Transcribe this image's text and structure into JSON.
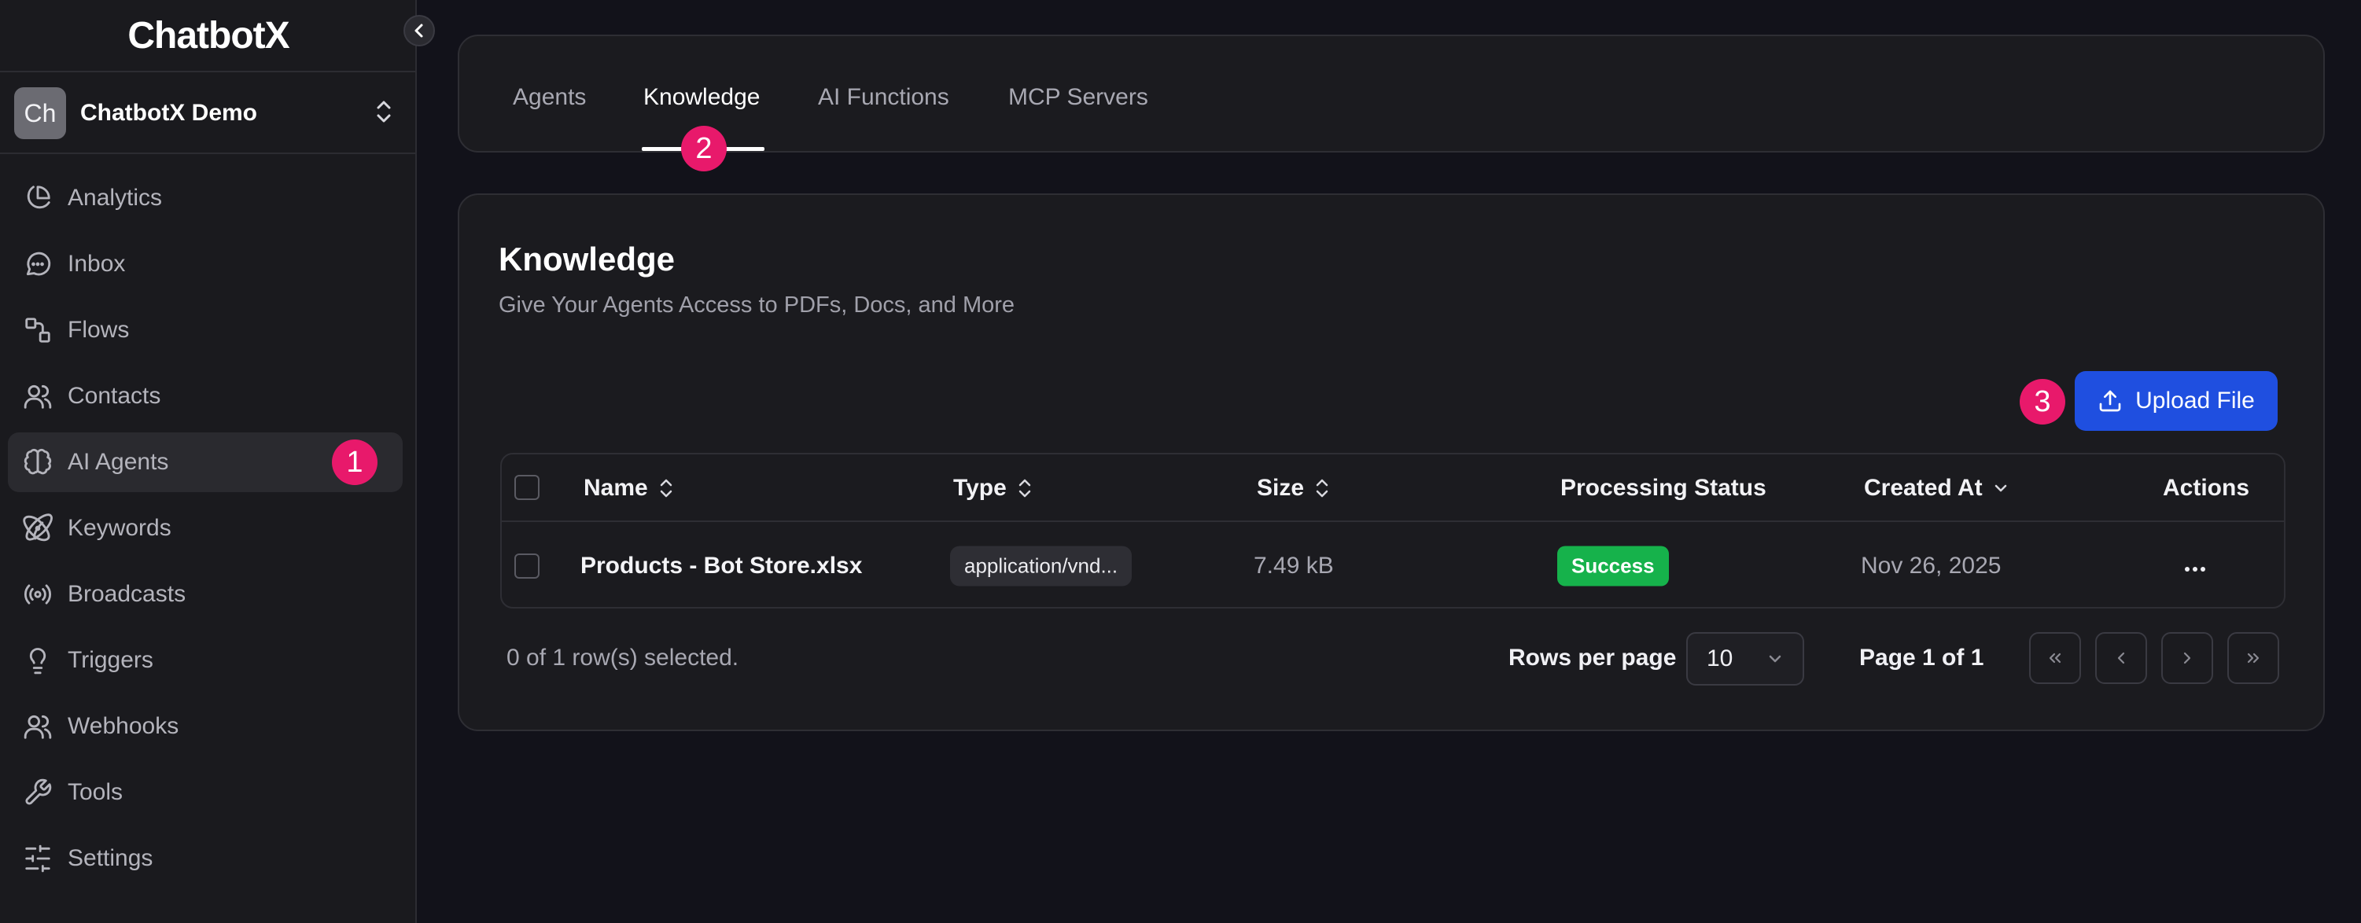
{
  "app": {
    "logo_text": "ChatbotX",
    "workspace": {
      "avatar_initials": "Ch",
      "name": "ChatbotX Demo"
    }
  },
  "sidebar": {
    "items": [
      {
        "label": "Analytics",
        "icon": "pie-chart-icon"
      },
      {
        "label": "Inbox",
        "icon": "chat-bubble-icon"
      },
      {
        "label": "Flows",
        "icon": "flow-icon"
      },
      {
        "label": "Contacts",
        "icon": "users-icon"
      },
      {
        "label": "AI Agents",
        "icon": "brain-icon",
        "active": true
      },
      {
        "label": "Keywords",
        "icon": "atom-icon"
      },
      {
        "label": "Broadcasts",
        "icon": "broadcast-icon"
      },
      {
        "label": "Triggers",
        "icon": "lightbulb-icon"
      },
      {
        "label": "Webhooks",
        "icon": "users-icon"
      },
      {
        "label": "Tools",
        "icon": "wrench-icon"
      },
      {
        "label": "Settings",
        "icon": "sliders-icon"
      }
    ]
  },
  "tabs": [
    {
      "label": "Agents"
    },
    {
      "label": "Knowledge",
      "active": true
    },
    {
      "label": "AI Functions"
    },
    {
      "label": "MCP Servers"
    }
  ],
  "main": {
    "title": "Knowledge",
    "subtitle": "Give Your Agents Access to PDFs, Docs, and More",
    "upload_label": "Upload File"
  },
  "table": {
    "columns": [
      "Name",
      "Type",
      "Size",
      "Processing Status",
      "Created At",
      "Actions"
    ],
    "rows": [
      {
        "name": "Products - Bot Store.xlsx",
        "type": "application/vnd...",
        "size": "7.49 kB",
        "status": "Success",
        "created_at": "Nov 26, 2025"
      }
    ]
  },
  "footer": {
    "selection": "0 of 1 row(s) selected.",
    "rows_per_page_label": "Rows per page",
    "rows_per_page_value": "10",
    "page_info": "Page 1 of 1"
  },
  "callouts": [
    "1",
    "2",
    "3"
  ],
  "colors": {
    "background": "#12121a",
    "panel": "#1b1b1f",
    "accent_blue": "#1f4fe0",
    "success_green": "#16b24b",
    "callout_pink": "#e8196b"
  }
}
